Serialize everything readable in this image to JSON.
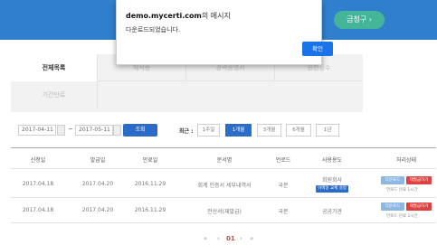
{
  "topbar": {
    "button_label": "금청구 ›"
  },
  "tabs": [
    {
      "label": "전체목록",
      "active": true
    },
    {
      "label": "재직증",
      "active": false
    },
    {
      "label": "경력증명서",
      "active": false
    },
    {
      "label": "원천징수",
      "active": false
    },
    {
      "label": "기간만료",
      "active": false
    }
  ],
  "filter": {
    "start_date": "2017-04-11",
    "separator": "~",
    "end_date": "2017-05-11",
    "search_label": "조회",
    "recent_label": "최근 :",
    "periods": [
      {
        "label": "1주일",
        "active": false
      },
      {
        "label": "1개월",
        "active": true
      },
      {
        "label": "3개월",
        "active": false
      },
      {
        "label": "6개월",
        "active": false
      },
      {
        "label": "1년",
        "active": false
      }
    ]
  },
  "table": {
    "headers": [
      "신청일",
      "발급일",
      "만료일",
      "문서명",
      "언로드",
      "사용용도",
      "처리상태"
    ],
    "rows": [
      {
        "applied": "2017.04.18",
        "issued": "2017.04.20",
        "expires": "2016.11.29",
        "document": "회계 인증서 세부내역서",
        "lang": "국문",
        "usage": "회원회사",
        "usage_tag": "이메일 교체 설정",
        "status_buttons": [
          "다운로드",
          "재발급하기"
        ],
        "status_note": "언로드 만료 1시간"
      },
      {
        "applied": "2017.04.18",
        "issued": "2017.04.20",
        "expires": "2016.11.29",
        "document": "전산서(재발급)",
        "lang": "국문",
        "usage": "공공기관",
        "usage_tag": "",
        "status_buttons": [
          "다운로드",
          "재발급하기"
        ],
        "status_note": "언로드 만료 1시간"
      }
    ]
  },
  "pager": {
    "first": "«",
    "prev": "‹",
    "current": "01",
    "next": "›",
    "last": "»"
  },
  "dialog": {
    "site": "demo.mycerti.com",
    "title_suffix": "의 메시지",
    "message": "다운로드되었습니다.",
    "ok_label": "확인"
  },
  "colors": {
    "topbar": "#2f7fcd",
    "accent": "#2b6cc8",
    "alert": "#e0413f",
    "top_button": "#45b59a"
  }
}
